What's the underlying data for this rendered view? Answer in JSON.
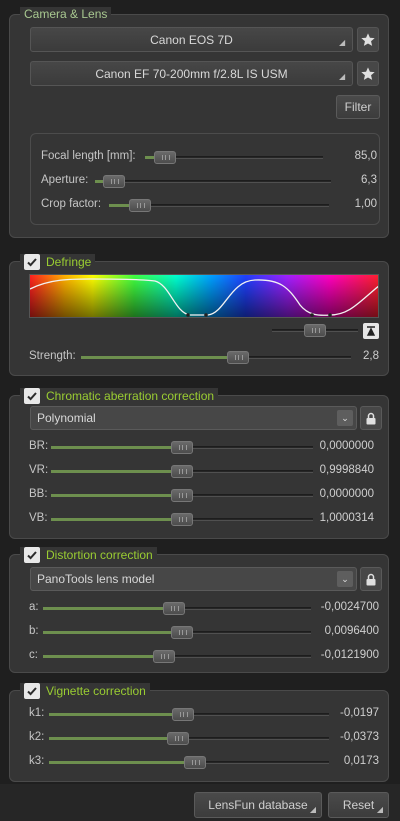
{
  "camera_lens": {
    "title": "Camera & Lens",
    "camera": "Canon EOS 7D",
    "lens": "Canon EF 70-200mm f/2.8L IS USM",
    "filter_label": "Filter",
    "params": [
      {
        "label": "Focal length [mm]:",
        "value": "85,0",
        "level": 0.11
      },
      {
        "label": "Aperture:",
        "value": "6,3",
        "level": 0.08
      },
      {
        "label": "Crop factor:",
        "value": "1,00",
        "level": 0.14
      }
    ]
  },
  "defringe": {
    "title": "Defringe",
    "strength_label": "Strength:",
    "strength_value": "2,8",
    "strength_level": 0.58
  },
  "chromatic": {
    "title": "Chromatic aberration correction",
    "model": "Polynomial",
    "params": [
      {
        "label": "BR:",
        "value": "0,0000000",
        "level": 0.5
      },
      {
        "label": "VR:",
        "value": "0,9998840",
        "level": 0.5
      },
      {
        "label": "BB:",
        "value": "0,0000000",
        "level": 0.5
      },
      {
        "label": "VB:",
        "value": "1,0000314",
        "level": 0.5
      }
    ]
  },
  "distortion": {
    "title": "Distortion correction",
    "model": "PanoTools lens model",
    "params": [
      {
        "label": "a:",
        "value": "-0,0024700",
        "level": 0.49
      },
      {
        "label": "b:",
        "value": "0,0096400",
        "level": 0.52
      },
      {
        "label": "c:",
        "value": "-0,0121900",
        "level": 0.45
      }
    ]
  },
  "vignette": {
    "title": "Vignette correction",
    "params": [
      {
        "label": "k1:",
        "value": "-0,0197",
        "level": 0.48
      },
      {
        "label": "k2:",
        "value": "-0,0373",
        "level": 0.46
      },
      {
        "label": "k3:",
        "value": "0,0173",
        "level": 0.52
      }
    ]
  },
  "footer": {
    "database_label": "LensFun database",
    "reset_label": "Reset"
  },
  "colors": {
    "accent_green": "#9acd32",
    "panel_bg": "#353535",
    "page_bg": "#1f1f1f"
  }
}
